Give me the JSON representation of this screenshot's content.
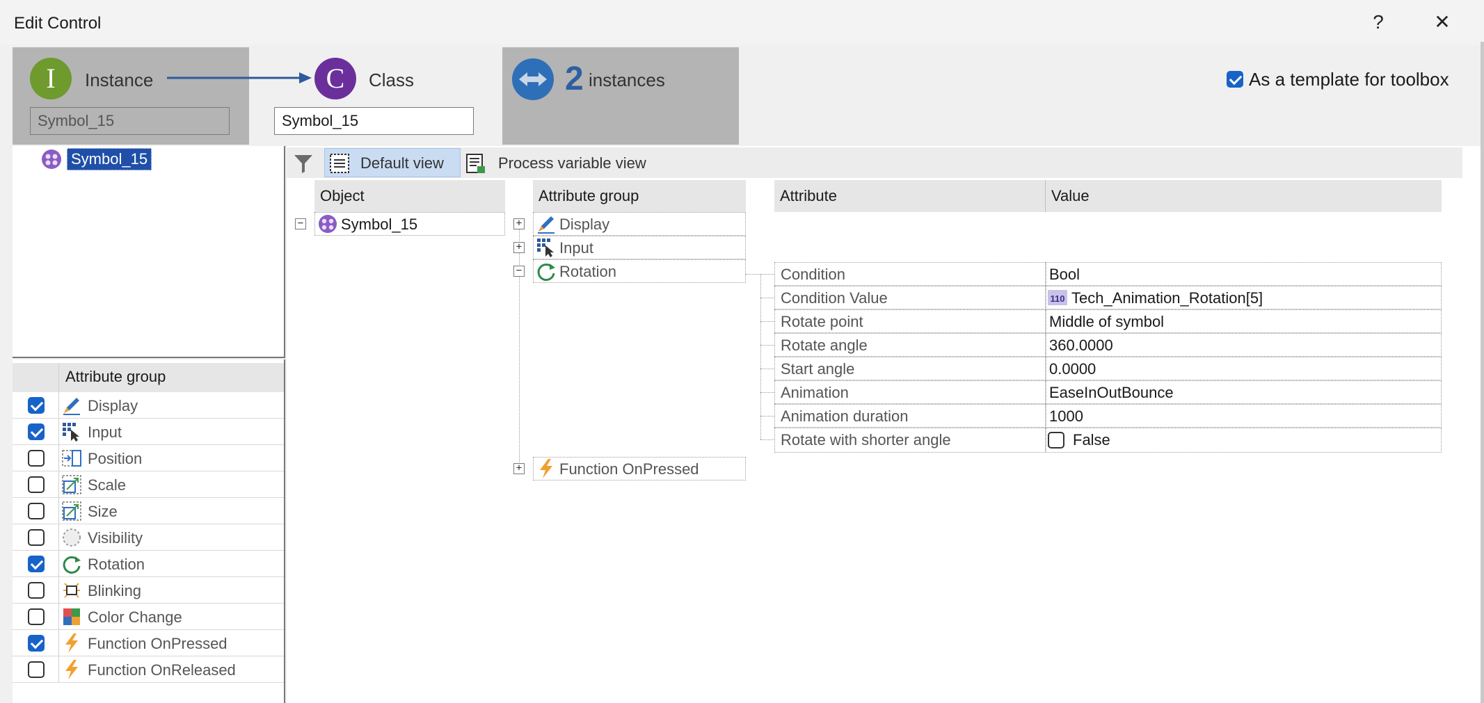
{
  "window": {
    "title": "Edit Control",
    "help_label": "?",
    "close_label": "✕"
  },
  "header": {
    "instance": {
      "letter": "I",
      "label": "Instance",
      "name": "Symbol_15",
      "color": "#6e9a2e"
    },
    "class": {
      "letter": "C",
      "label": "Class",
      "name": "Symbol_15",
      "color": "#6b2f9b"
    },
    "instances": {
      "count": "2",
      "label": "instances",
      "color": "#2e6fb8"
    },
    "template_checkbox": {
      "label": "As a template for toolbox",
      "checked": true
    }
  },
  "tree": {
    "root": "Symbol_15"
  },
  "left_groups": {
    "header": "Attribute group",
    "items": [
      {
        "label": "Display",
        "checked": true,
        "icon": "display-icon"
      },
      {
        "label": "Input",
        "checked": true,
        "icon": "input-icon"
      },
      {
        "label": "Position",
        "checked": false,
        "icon": "position-icon"
      },
      {
        "label": "Scale",
        "checked": false,
        "icon": "scale-icon"
      },
      {
        "label": "Size",
        "checked": false,
        "icon": "size-icon"
      },
      {
        "label": "Visibility",
        "checked": false,
        "icon": "visibility-icon"
      },
      {
        "label": "Rotation",
        "checked": true,
        "icon": "rotation-icon"
      },
      {
        "label": "Blinking",
        "checked": false,
        "icon": "blinking-icon"
      },
      {
        "label": "Color Change",
        "checked": false,
        "icon": "color-change-icon"
      },
      {
        "label": "Function OnPressed",
        "checked": true,
        "icon": "lightning-icon"
      },
      {
        "label": "Function OnReleased",
        "checked": false,
        "icon": "lightning-icon"
      }
    ]
  },
  "toolbar": {
    "default_view": "Default view",
    "process_view": "Process variable view"
  },
  "main": {
    "object_header": "Object",
    "object_name": "Symbol_15",
    "group_header": "Attribute group",
    "groups": [
      {
        "label": "Display",
        "expanded": false
      },
      {
        "label": "Input",
        "expanded": false
      },
      {
        "label": "Rotation",
        "expanded": true
      },
      {
        "label": "Function OnPressed",
        "expanded": false
      }
    ],
    "attr_header": "Attribute",
    "value_header": "Value",
    "attributes": [
      {
        "name": "Condition",
        "value": "Bool"
      },
      {
        "name": "Condition Value",
        "value": "Tech_Animation_Rotation[5]",
        "badge": "110"
      },
      {
        "name": "Rotate point",
        "value": "Middle of symbol"
      },
      {
        "name": "Rotate angle",
        "value": "360.0000"
      },
      {
        "name": "Start angle",
        "value": "0.0000"
      },
      {
        "name": "Animation",
        "value": "EaseInOutBounce"
      },
      {
        "name": "Animation duration",
        "value": "1000"
      },
      {
        "name": "Rotate with shorter angle",
        "value": "False",
        "checkbox": true
      }
    ]
  }
}
